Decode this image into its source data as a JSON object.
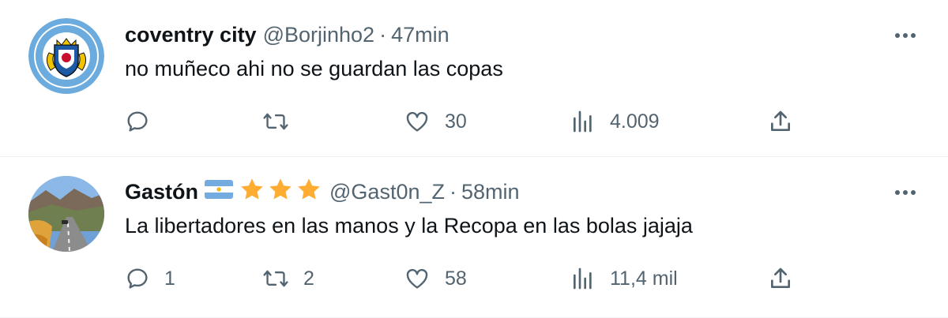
{
  "tweets": [
    {
      "name": "coventry city",
      "handle": "@Borjinho2",
      "separator": "·",
      "time": "47min",
      "text": "no muñeco ahi no se guardan las copas",
      "avatar_icon": "coventry-city-crest",
      "badges": [],
      "actions": {
        "reply": "",
        "retweet": "",
        "like": "30",
        "views": "4.009"
      }
    },
    {
      "name": "Gastón",
      "handle": "@Gast0n_Z",
      "separator": "·",
      "time": "58min",
      "text": "La libertadores en las manos y la Recopa en las bolas jajaja",
      "avatar_icon": "mountain-road-photo",
      "badges": [
        "argentina-flag",
        "star",
        "star",
        "star"
      ],
      "actions": {
        "reply": "1",
        "retweet": "2",
        "like": "58",
        "views": "11,4 mil"
      }
    }
  ],
  "colors": {
    "primary_text": "#0f1419",
    "secondary_text": "#536471",
    "divider": "#eff3f4",
    "star": "#ffac33",
    "flag_blue": "#74acdf"
  }
}
